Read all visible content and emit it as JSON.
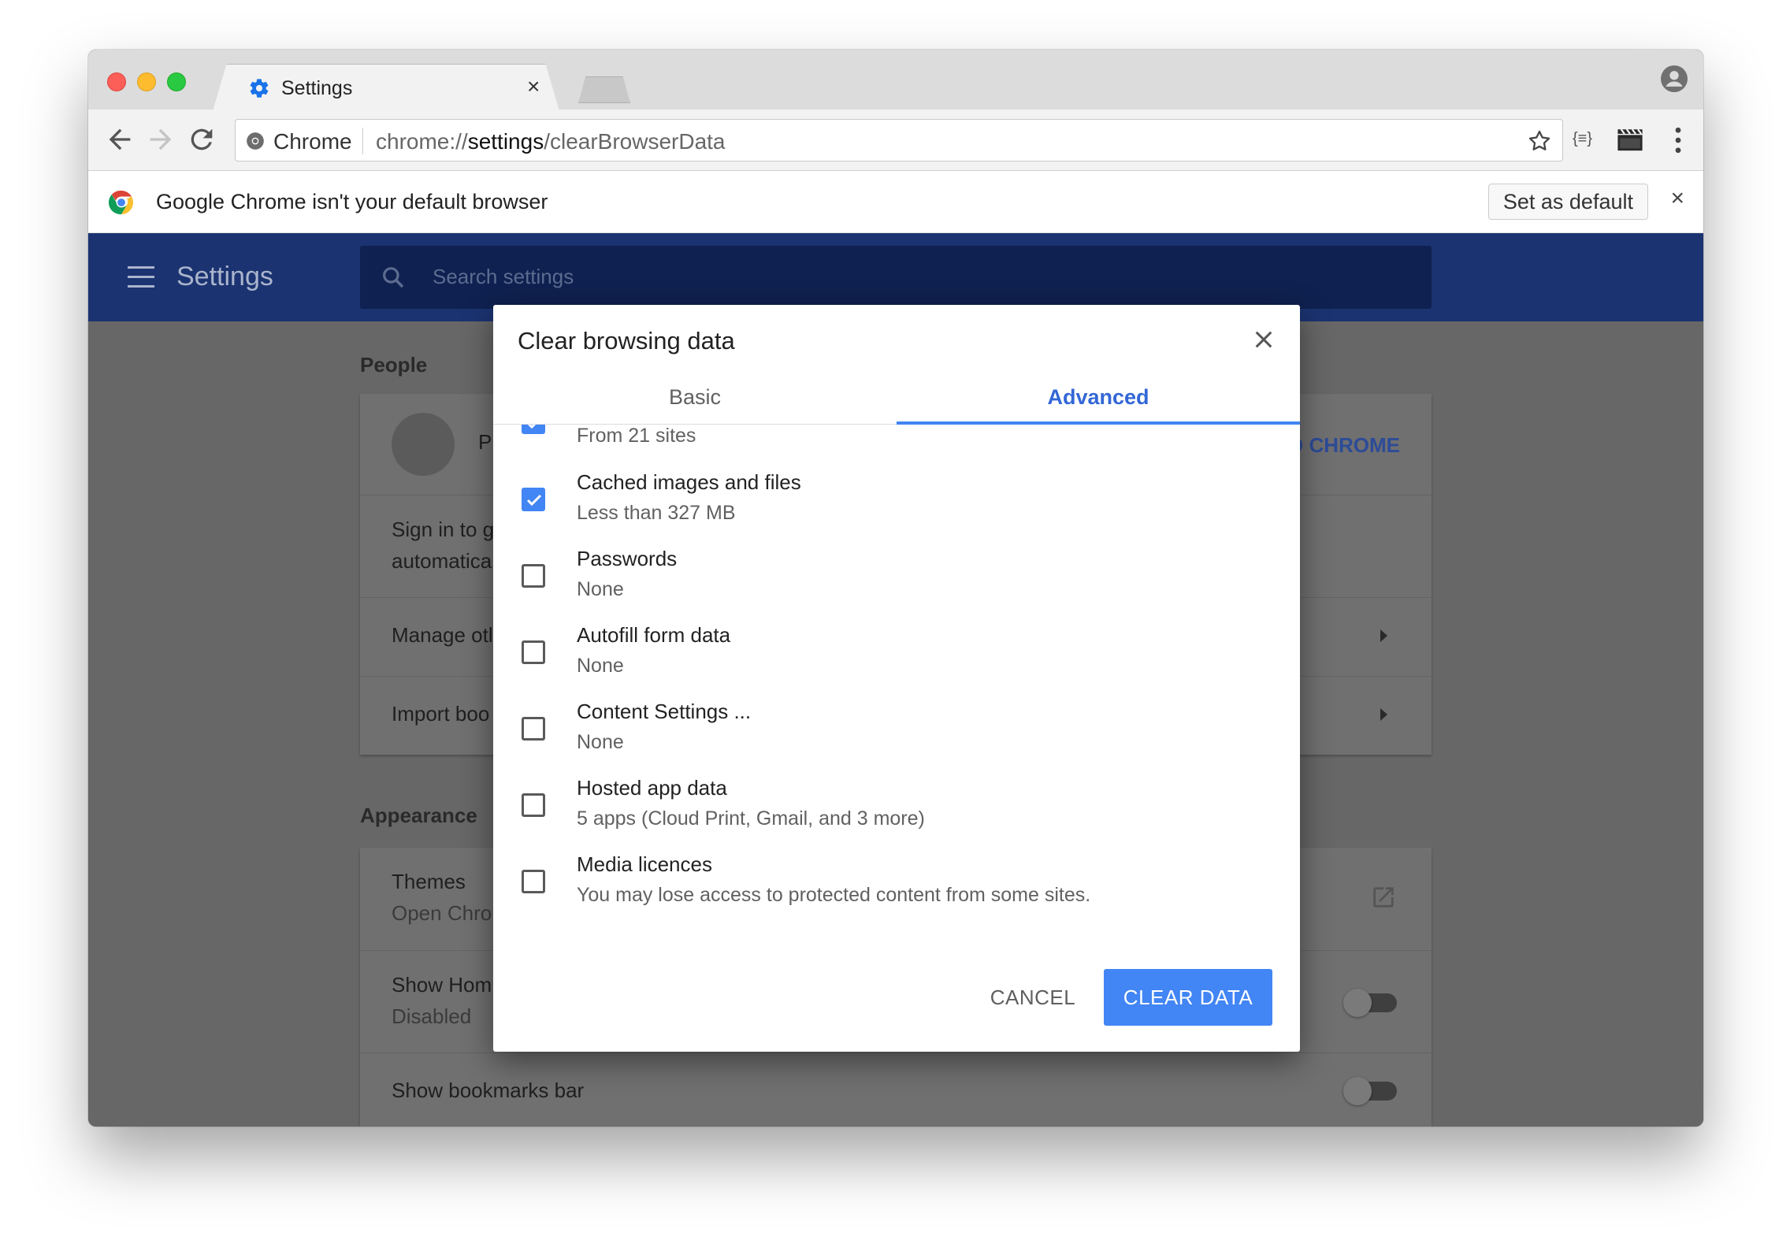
{
  "browser": {
    "tab_title": "Settings",
    "tab_close": "×",
    "omnibox": {
      "site_label": "Chrome",
      "url_scheme": "chrome://",
      "url_host": "settings",
      "url_path": "/clearBrowserData"
    },
    "ext_label": "{≡}"
  },
  "infobar": {
    "message": "Google Chrome isn't your default browser",
    "set_default_label": "Set as default",
    "close": "×"
  },
  "settings": {
    "title": "Settings",
    "search_placeholder": "Search settings",
    "people": {
      "section": "People",
      "profile_initial": "P",
      "sign_in_link": "O CHROME",
      "sign_in_text_1": "Sign in to g",
      "sign_in_text_2": "automatica",
      "manage_other": "Manage otl",
      "import": "Import boo"
    },
    "appearance": {
      "section": "Appearance",
      "themes": "Themes",
      "themes_sub": "Open Chror",
      "show_home": "Show Hom",
      "show_home_sub": "Disabled",
      "show_bookmarks": "Show bookmarks bar"
    }
  },
  "dialog": {
    "title": "Clear browsing data",
    "tabs": [
      {
        "label": "Basic",
        "active": false
      },
      {
        "label": "Advanced",
        "active": true
      }
    ],
    "items": [
      {
        "title": "",
        "sub": "From 21 sites",
        "checked": true
      },
      {
        "title": "Cached images and files",
        "sub": "Less than 327 MB",
        "checked": true
      },
      {
        "title": "Passwords",
        "sub": "None",
        "checked": false
      },
      {
        "title": "Autofill form data",
        "sub": "None",
        "checked": false
      },
      {
        "title": "Content Settings ...",
        "sub": "None",
        "checked": false
      },
      {
        "title": "Hosted app data",
        "sub": "5 apps (Cloud Print, Gmail, and 3 more)",
        "checked": false
      },
      {
        "title": "Media licences",
        "sub": "You may lose access to protected content from some sites.",
        "checked": false
      }
    ],
    "cancel_label": "CANCEL",
    "clear_label": "CLEAR DATA"
  },
  "colors": {
    "accent": "#4285f4",
    "header": "#1b3371",
    "overlay": "#676767"
  }
}
